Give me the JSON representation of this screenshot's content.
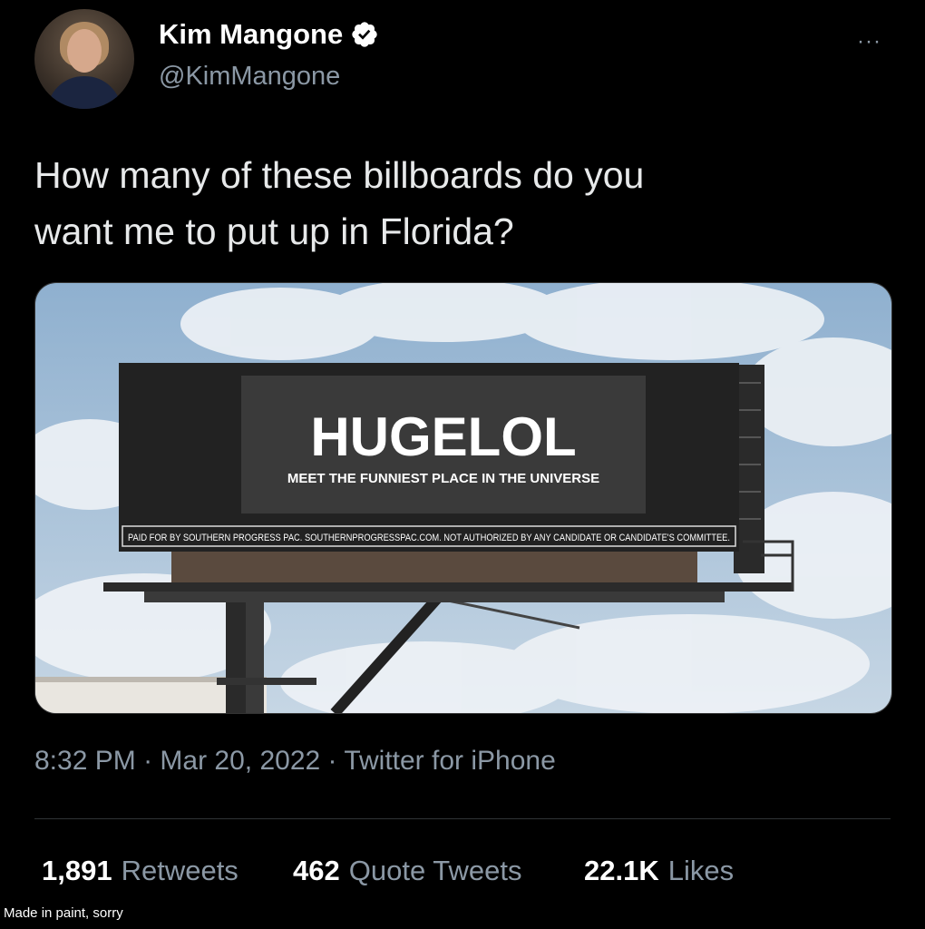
{
  "author": {
    "name": "Kim Mangone",
    "handle": "@KimMangone",
    "verified": true
  },
  "more_icon": "···",
  "tweet": {
    "text_line1": "How many of these billboards do you",
    "text_line2": "want me to put up in Florida?"
  },
  "media": {
    "billboard_title": "HUGELOL",
    "billboard_subtitle": "MEET THE FUNNIEST PLACE IN THE UNIVERSE",
    "billboard_disclaimer": "PAID FOR BY SOUTHERN PROGRESS PAC. SOUTHERNPROGRESSPAC.COM. NOT AUTHORIZED BY ANY CANDIDATE OR CANDIDATE'S COMMITTEE."
  },
  "meta": {
    "time": "8:32 PM",
    "date": "Mar 20, 2022",
    "source": "Twitter for iPhone",
    "separator": " · "
  },
  "stats": {
    "retweets_count": "1,891",
    "retweets_label": "Retweets",
    "quotes_count": "462",
    "quotes_label": "Quote Tweets",
    "likes_count": "22.1K",
    "likes_label": "Likes"
  },
  "caption": "Made in paint, sorry",
  "colors": {
    "background": "#000000",
    "text": "#e7e9ea",
    "muted": "#8b98a5",
    "verified": "#ffffff"
  }
}
